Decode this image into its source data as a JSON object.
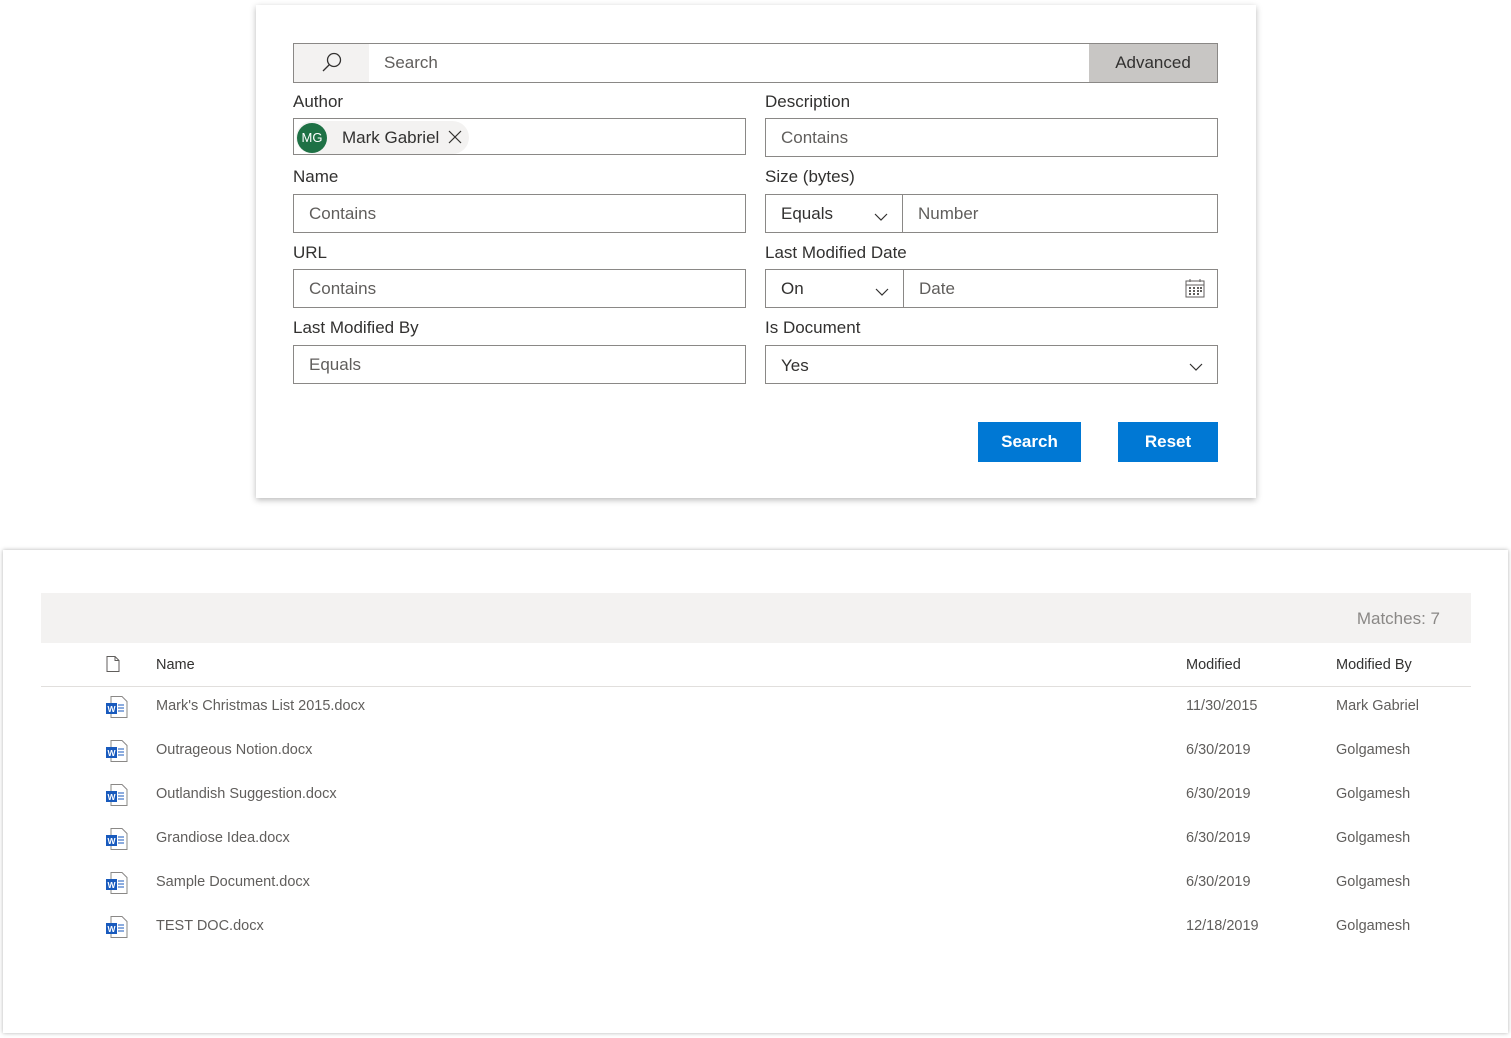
{
  "search": {
    "placeholder": "Search",
    "advanced_label": "Advanced"
  },
  "fields": {
    "author": {
      "label": "Author",
      "persona_initials": "MG",
      "persona_name": "Mark Gabriel",
      "persona_color": "#1e7145"
    },
    "description": {
      "label": "Description",
      "placeholder": "Contains"
    },
    "name": {
      "label": "Name",
      "placeholder": "Contains"
    },
    "size": {
      "label": "Size (bytes)",
      "operator": "Equals",
      "placeholder": "Number"
    },
    "url": {
      "label": "URL",
      "placeholder": "Contains"
    },
    "last_modified_date": {
      "label": "Last Modified Date",
      "operator": "On",
      "placeholder": "Date"
    },
    "last_modified_by": {
      "label": "Last Modified By",
      "placeholder": "Equals"
    },
    "is_document": {
      "label": "Is Document",
      "value": "Yes"
    }
  },
  "actions": {
    "search_label": "Search",
    "reset_label": "Reset",
    "button_color": "#0078d4"
  },
  "results": {
    "matches_text": "Matches: 7",
    "columns": {
      "name": "Name",
      "modified": "Modified",
      "modified_by": "Modified By"
    },
    "rows": [
      {
        "name": "Mark's Christmas List 2015.docx",
        "modified": "11/30/2015",
        "modified_by": "Mark Gabriel",
        "icon": "word-doc-icon"
      },
      {
        "name": "Outrageous Notion.docx",
        "modified": "6/30/2019",
        "modified_by": "Golgamesh",
        "icon": "word-doc-icon"
      },
      {
        "name": "Outlandish Suggestion.docx",
        "modified": "6/30/2019",
        "modified_by": "Golgamesh",
        "icon": "word-doc-icon"
      },
      {
        "name": "Grandiose Idea.docx",
        "modified": "6/30/2019",
        "modified_by": "Golgamesh",
        "icon": "word-doc-icon"
      },
      {
        "name": "Sample Document.docx",
        "modified": "6/30/2019",
        "modified_by": "Golgamesh",
        "icon": "word-doc-icon"
      },
      {
        "name": "TEST DOC.docx",
        "modified": "12/18/2019",
        "modified_by": "Golgamesh",
        "icon": "word-doc-icon"
      }
    ]
  }
}
